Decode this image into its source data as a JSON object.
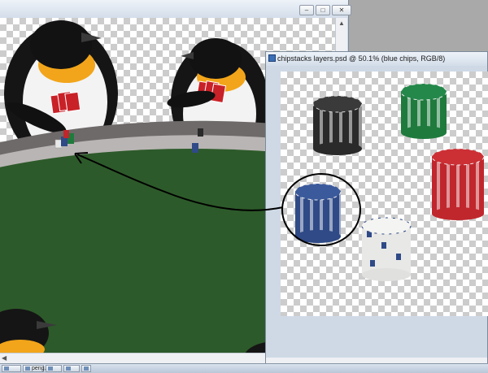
{
  "back_window": {
    "controls": {
      "minimize": "–",
      "maximize": "□",
      "close": "✕"
    }
  },
  "front_window": {
    "title": "chipstacks layers.psd @ 50.1% (blue chips, RGB/8)",
    "app_icon": "photoshop-document-icon"
  },
  "taskbar": {
    "items": [
      {
        "label": "",
        "icon": "window-icon"
      },
      {
        "label": "peng...",
        "icon": "photoshop-document-icon"
      },
      {
        "label": "",
        "icon": "window-icon"
      },
      {
        "label": "",
        "icon": "window-icon"
      },
      {
        "label": "",
        "icon": "window-icon"
      }
    ]
  },
  "colors": {
    "table_felt": "#2d5a2a",
    "table_rail": "#6e6a69",
    "chip_black": "#2a2a2a",
    "chip_green": "#1f7a3d",
    "chip_red": "#c0272d",
    "chip_blue": "#2f4a86",
    "chip_white": "#e8e8e6",
    "annotation": "#000000"
  },
  "annotation": {
    "type": "hand-drawn circle and arrow",
    "from": "blue chips",
    "to": "chip stacks on table"
  }
}
